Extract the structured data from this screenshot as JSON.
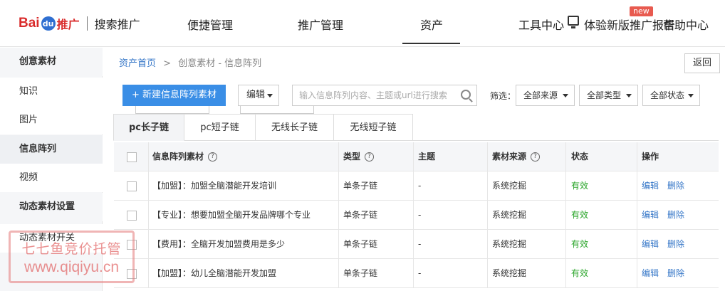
{
  "header": {
    "logo_bai": "Bai",
    "logo_du": "du",
    "logo_tuiguang": "推广",
    "product": "搜索推广",
    "nav": [
      "便捷管理",
      "推广管理",
      "资产"
    ],
    "tools": "工具中心",
    "new_version": "体验新版",
    "report": "推广报告",
    "help": "帮助中心",
    "new_badge": "new"
  },
  "sidebar": {
    "items": [
      "创意素材",
      "知识",
      "图片",
      "信息阵列",
      "视频",
      "动态素材设置",
      "动态素材开关"
    ]
  },
  "breadcrumb": {
    "home": "资产首页",
    "sep": ">",
    "current": "创意素材 - 信息阵列"
  },
  "toolbar": {
    "back": "返回",
    "new_button": "+ 新建信息阵列素材",
    "edit": "编辑",
    "search_placeholder": "输入信息阵列内容、主题或url进行搜索",
    "filter_label": "筛选：",
    "filters": [
      "全部来源",
      "全部类型",
      "全部状态"
    ]
  },
  "tabs": [
    "pc长子链",
    "pc短子链",
    "无线长子链",
    "无线短子链"
  ],
  "table": {
    "headers": [
      "信息阵列素材",
      "类型",
      "主题",
      "素材来源",
      "状态",
      "操作"
    ],
    "rows": [
      {
        "material": "【加盟】：加盟全脑潜能开发培训",
        "type": "单条子链",
        "theme": "-",
        "source": "系统挖掘",
        "status": "有效"
      },
      {
        "material": "【专业】：想要加盟全脑开发品牌哪个专业",
        "type": "单条子链",
        "theme": "-",
        "source": "系统挖掘",
        "status": "有效"
      },
      {
        "material": "【费用】：全脑开发加盟费用是多少",
        "type": "单条子链",
        "theme": "-",
        "source": "系统挖掘",
        "status": "有效"
      },
      {
        "material": "【加盟】：幼儿全脑潜能开发加盟",
        "type": "单条子链",
        "theme": "-",
        "source": "系统挖掘",
        "status": "有效"
      }
    ],
    "edit": "编辑",
    "delete": "删除"
  },
  "watermark": {
    "line1": "七七鱼竞价托管",
    "line2": "www.qiqiyu.cn"
  },
  "colors": {
    "accent": "#3a8ee6",
    "link": "#3677c8",
    "status_ok": "#2aa52a",
    "brand_red": "#d92b2b"
  }
}
